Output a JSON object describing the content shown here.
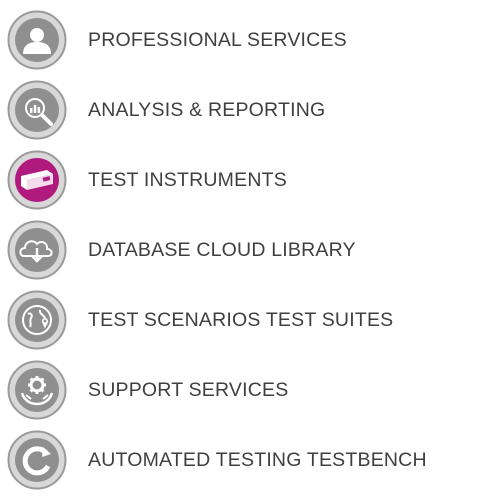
{
  "colors": {
    "ring_outer": "#9a9a9a",
    "ring_fill": "#d8d8d8",
    "inner_disc": "#8f8f8f",
    "active_inner": "#b0197e",
    "glyph": "#ffffff",
    "text": "#3f3f3f"
  },
  "menu": {
    "items": [
      {
        "label": "PROFESSIONAL SERVICES",
        "icon": "person-icon",
        "active": false
      },
      {
        "label": "ANALYSIS & REPORTING",
        "icon": "magnifier-chart-icon",
        "active": false
      },
      {
        "label": "TEST INSTRUMENTS",
        "icon": "instrument-box-icon",
        "active": true
      },
      {
        "label": "DATABASE CLOUD LIBRARY",
        "icon": "cloud-download-icon",
        "active": false
      },
      {
        "label": "TEST SCENARIOS TEST SUITES",
        "icon": "globe-pin-icon",
        "active": false
      },
      {
        "label": "SUPPORT SERVICES",
        "icon": "gear-hands-icon",
        "active": false
      },
      {
        "label": "AUTOMATED TESTING TESTBENCH",
        "icon": "refresh-icon",
        "active": false
      }
    ]
  }
}
